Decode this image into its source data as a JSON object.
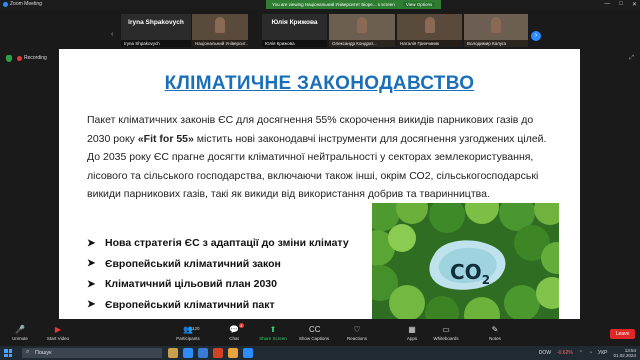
{
  "window": {
    "app_title": "Zoom Meeting",
    "banner_text": "You are viewing Національний Університет Біоре... s screen",
    "view_options": "View Options",
    "controls": [
      "—",
      "□",
      "✕"
    ]
  },
  "video_strip": {
    "tiles": [
      {
        "bigname": "Iryna Shpakovych",
        "label": "Iryna Shpakovych",
        "type": "name"
      },
      {
        "bigname": "",
        "label": "Національний Університ...",
        "type": "video"
      },
      {
        "bigname": "Юлія Крижова",
        "label": "Юлія Крижова",
        "type": "name"
      },
      {
        "bigname": "",
        "label": "Олександр Кондрат...",
        "type": "video2"
      },
      {
        "bigname": "",
        "label": "Наталія Гринчиник",
        "type": "video"
      },
      {
        "bigname": "",
        "label": "Володимир Калуга",
        "type": "video2"
      }
    ]
  },
  "recording": {
    "label": "Recording"
  },
  "slide": {
    "title": "КЛІМАТИЧНЕ ЗАКОНОДАВСТВО",
    "body_before": "Пакет кліматичних законів ЄС для досягнення 55% скорочення викидів парникових газів до 2030 року ",
    "body_bold": "«Fit for 55»",
    "body_after": " містить нові законодавчі інструменти для досягнення узгоджених цілей. До 2035 року ЄС прагне досягти кліматичної нейтральності у секторах землекористування, лісового та сільського господарства, включаючи також інші, окрім СО2, сільськогосподарські викиди парникових газів, такі як викиди від використання добрив та тваринництва.",
    "bullets": [
      "Нова стратегія ЄС з адаптації до зміни клімату",
      "Європейський кліматичний закон",
      "Кліматичний цільовий план 2030",
      "Європейський кліматичний пакт"
    ],
    "image_text": "CO",
    "image_sub": "2"
  },
  "toolbar": {
    "items": [
      {
        "label": "Unmute",
        "icon": "🎤"
      },
      {
        "label": "Start Video",
        "icon": "▶"
      },
      {
        "label": "Participants",
        "icon": "👥",
        "count": "120"
      },
      {
        "label": "Chat",
        "icon": "💬",
        "badge": "4"
      },
      {
        "label": "Share Screen",
        "icon": "⬆"
      },
      {
        "label": "Show Captions",
        "icon": "CC"
      },
      {
        "label": "Reactions",
        "icon": "♡"
      },
      {
        "label": "Apps",
        "icon": "▦"
      },
      {
        "label": "Whiteboards",
        "icon": "▭"
      },
      {
        "label": "Notes",
        "icon": "✎"
      }
    ],
    "leave": "Leave"
  },
  "taskbar": {
    "search_placeholder": "Пошук",
    "ticker": "DOW",
    "ticker_value": "-0.62%",
    "lang": "УКР",
    "time": "13:54",
    "date": "01.02.2024"
  },
  "colors": {
    "title_blue": "#1b6fb8",
    "share_green": "#2ecc71",
    "leave_red": "#e02828",
    "banner_green": "#2e7d32"
  }
}
